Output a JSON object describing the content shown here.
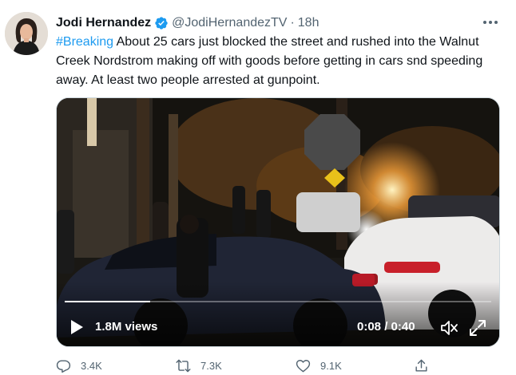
{
  "author": {
    "display_name": "Jodi Hernandez",
    "handle": "@JodiHernandezTV",
    "separator": "·",
    "time": "18h",
    "verified_icon": "verified-badge-icon",
    "avatar_icon": "profile-photo"
  },
  "tweet": {
    "hashtag": "#Breaking",
    "body": " About 25 cars just blocked the street and rushed into the Walnut Creek Nordstrom making off with goods before getting in cars snd speeding away. At least two people arrested at gunpoint."
  },
  "video": {
    "views": "1.8M views",
    "timecode": "0:08 / 0:40",
    "progress": 0.2,
    "play_icon": "play-icon",
    "mute_icon": "muted-icon",
    "fullscreen_icon": "fullscreen-icon"
  },
  "actions": {
    "replies": "3.4K",
    "retweets": "7.3K",
    "likes": "9.1K",
    "reply_icon": "reply-icon",
    "retweet_icon": "retweet-icon",
    "like_icon": "heart-icon",
    "share_icon": "share-icon"
  },
  "colors": {
    "accent": "#1d9bf0",
    "secondary_text": "#536471",
    "primary_text": "#0f1419"
  }
}
